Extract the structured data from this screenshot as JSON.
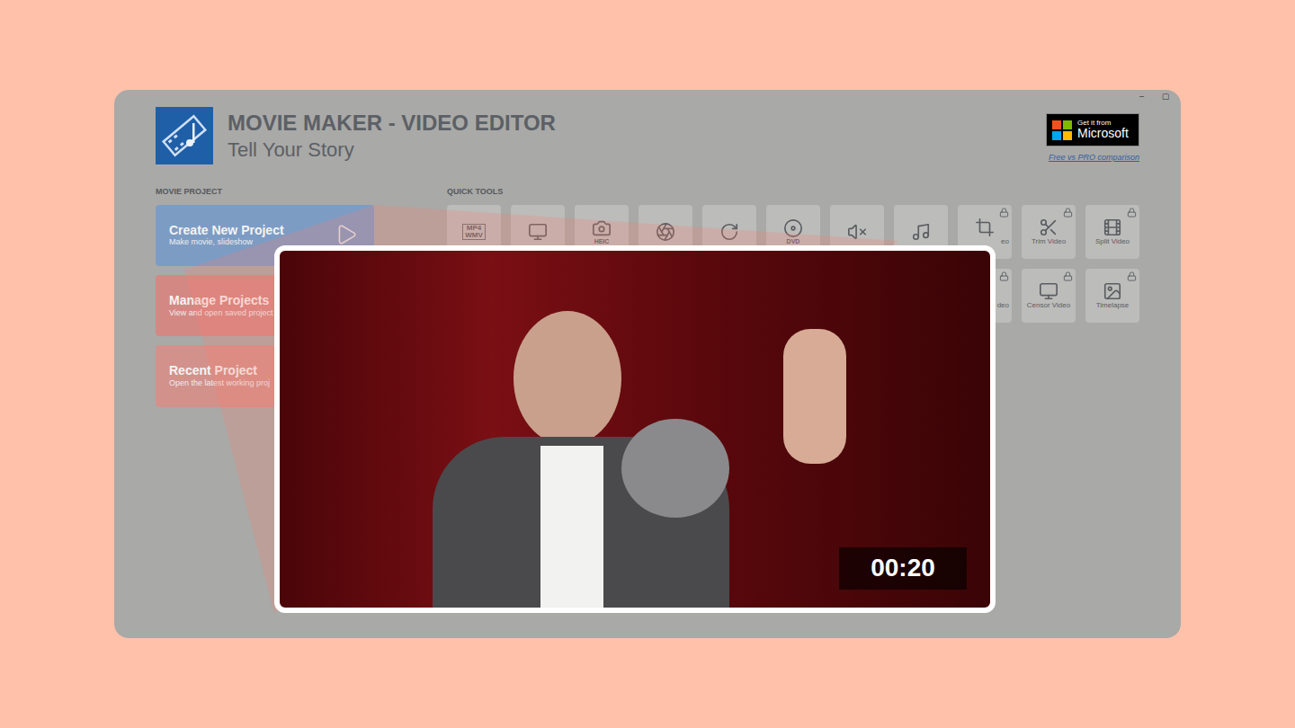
{
  "window": {
    "title": "MOVIE MAKER - VIDEO EDITOR",
    "subtitle": "Tell Your Story",
    "controls": [
      "–",
      "▢"
    ]
  },
  "store_badge": {
    "small": "Get it from",
    "large": "Microsoft",
    "link": "Free vs PRO comparison"
  },
  "movie_project": {
    "heading": "MOVIE PROJECT",
    "cards": [
      {
        "title": "Create New Project",
        "subtitle": "Make movie, slideshow",
        "color": "#7d9cc4"
      },
      {
        "title": "Manage Projects",
        "subtitle": "View and open saved project",
        "color": "#d48884"
      },
      {
        "title": "Recent Project",
        "subtitle": "Open the latest working proj",
        "color": "#d3918b"
      }
    ]
  },
  "quick_tools": {
    "heading": "QUICK TOOLS",
    "rows": [
      [
        {
          "kind": "icon",
          "text": [
            "MP4",
            "WMV"
          ],
          "label": "",
          "locked": false
        },
        {
          "kind": "icon",
          "text": [],
          "label": "",
          "locked": false
        },
        {
          "kind": "icon",
          "text": [
            "HEIC"
          ],
          "label": "",
          "locked": false
        },
        {
          "kind": "icon",
          "text": [],
          "label": "",
          "locked": false
        },
        {
          "kind": "icon",
          "text": [],
          "label": "",
          "locked": false
        },
        {
          "kind": "icon",
          "text": [
            "DVD"
          ],
          "label": "",
          "locked": false
        },
        {
          "kind": "icon",
          "text": [],
          "label": "",
          "locked": false
        },
        {
          "kind": "icon",
          "text": [],
          "label": "",
          "locked": false
        },
        {
          "kind": "cut",
          "text": [],
          "label": "eo",
          "locked": true
        },
        {
          "kind": "full",
          "text": [],
          "label": "Trim Video",
          "locked": true
        },
        {
          "kind": "full",
          "text": [],
          "label": "Split Video",
          "locked": true
        }
      ],
      [
        {
          "kind": "cut",
          "text": [],
          "label": "deo",
          "locked": true
        },
        {
          "kind": "full",
          "text": [],
          "label": "Censor Video",
          "locked": true
        },
        {
          "kind": "full",
          "text": [],
          "label": "Timelapse",
          "locked": true
        }
      ]
    ]
  },
  "video": {
    "time": "00:20"
  }
}
